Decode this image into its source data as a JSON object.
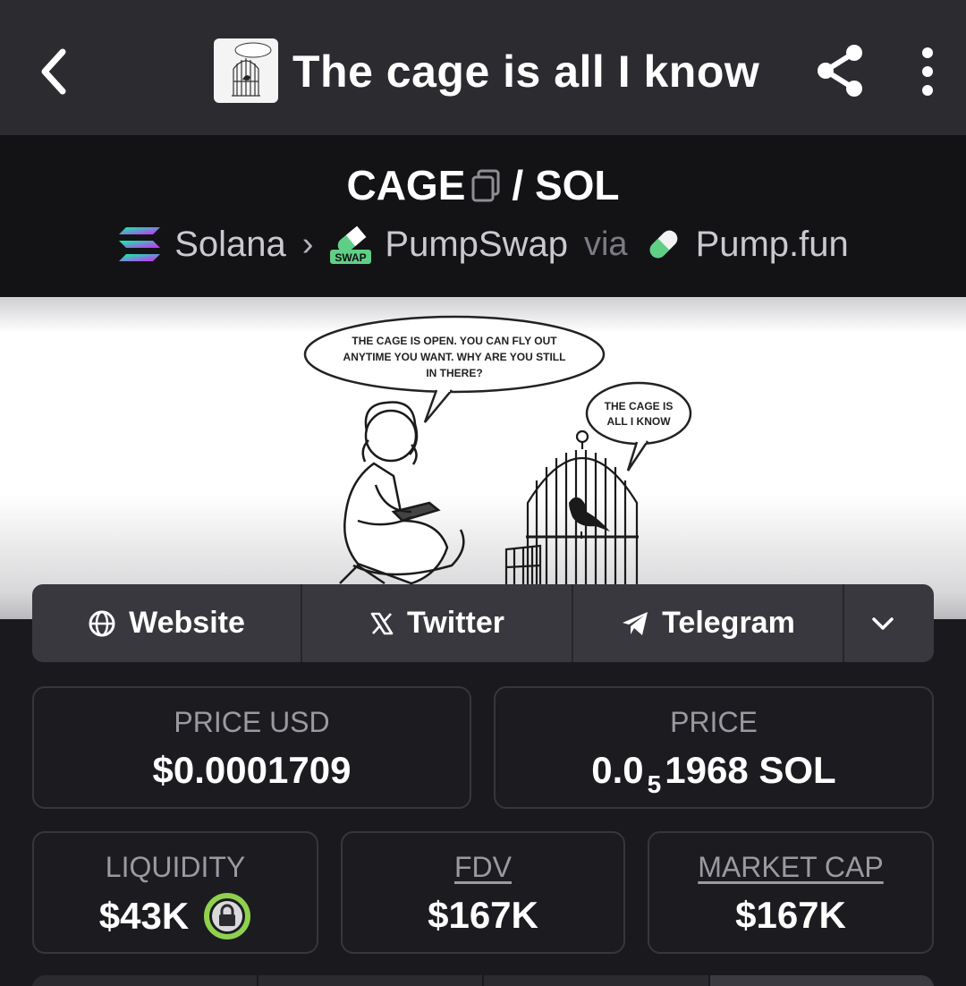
{
  "header": {
    "title": "The cage is all I know"
  },
  "pair": {
    "base": "CAGE",
    "separator": "/",
    "quote": "SOL"
  },
  "route": {
    "chain": "Solana",
    "dex": "PumpSwap",
    "dex_badge": "SWAP",
    "via": "via",
    "launchpad": "Pump.fun"
  },
  "banner": {
    "speech_woman_1": "THE CAGE IS OPEN. YOU CAN FLY OUT",
    "speech_woman_2": "ANYTIME YOU WANT. WHY ARE YOU STILL",
    "speech_woman_3": "IN THERE?",
    "speech_bird_1": "THE CAGE IS",
    "speech_bird_2": "ALL I KNOW"
  },
  "links": {
    "website": "Website",
    "twitter": "Twitter",
    "telegram": "Telegram"
  },
  "stats": {
    "price_usd_label": "PRICE USD",
    "price_usd": "$0.0001709",
    "price_label": "PRICE",
    "price_sol_prefix": "0.0",
    "price_sol_zeros": "5",
    "price_sol_suffix": "1968 SOL",
    "liquidity_label": "LIQUIDITY",
    "liquidity": "$43K",
    "fdv_label": "FDV",
    "fdv": "$167K",
    "mcap_label": "MARKET CAP",
    "mcap": "$167K"
  },
  "colors": {
    "topbar": "#2b2b30",
    "pairbar": "#131316",
    "page": "#1a1a1e",
    "lock_green": "#8fd14f"
  },
  "icons": {
    "back": "chevron-left-icon",
    "share": "share-icon",
    "more": "more-vertical-icon",
    "copy": "copy-icon",
    "website": "globe-icon",
    "twitter": "x-logo-icon",
    "telegram": "telegram-icon",
    "expand": "chevron-down-icon",
    "liquidity_lock": "lock-icon"
  }
}
